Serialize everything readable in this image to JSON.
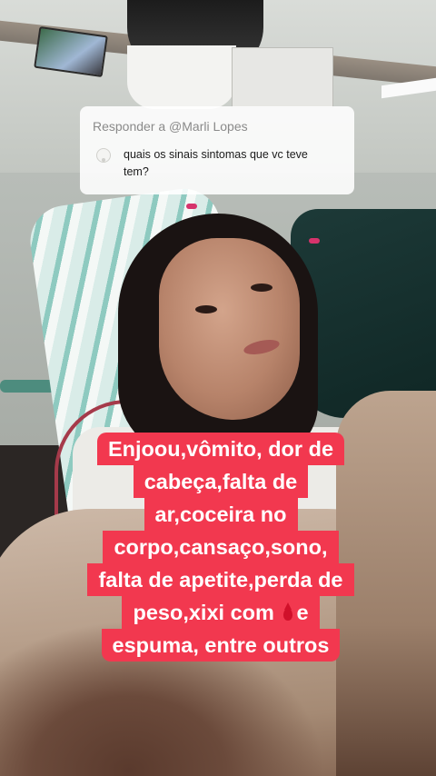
{
  "reply": {
    "header": "Responder a @Marli Lopes",
    "comment_line1": "quais os sinais sintomas que vc teve",
    "comment_line2": "tem?"
  },
  "caption": {
    "lines": [
      "Enjoou,vômito, dor de",
      "cabeça,falta de",
      "ar,coceira no",
      "corpo,cansaço,sono,",
      "falta de apetite,perda de",
      "peso,xixi com",
      "e",
      "espuma, entre outros"
    ],
    "inline_icon": "blood-drop-icon",
    "background_color": "#f2384f",
    "text_color": "#ffffff"
  }
}
